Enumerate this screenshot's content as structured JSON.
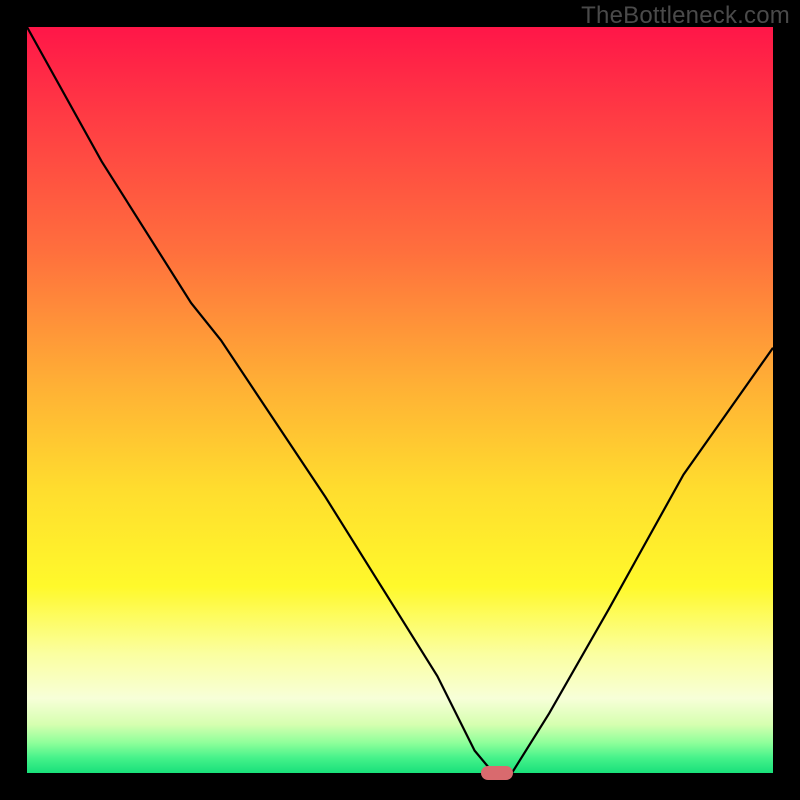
{
  "watermark": "TheBottleneck.com",
  "colors": {
    "frame": "#000000",
    "marker": "#d96a6e",
    "curve": "#000000"
  },
  "gradient_stops": [
    {
      "pct": 0,
      "color": "#ff1648"
    },
    {
      "pct": 12,
      "color": "#ff3b44"
    },
    {
      "pct": 30,
      "color": "#ff6f3d"
    },
    {
      "pct": 48,
      "color": "#ffb035"
    },
    {
      "pct": 62,
      "color": "#ffdd2e"
    },
    {
      "pct": 75,
      "color": "#fff92b"
    },
    {
      "pct": 84,
      "color": "#fbffa0"
    },
    {
      "pct": 90,
      "color": "#f7ffd8"
    },
    {
      "pct": 93.5,
      "color": "#d6ffb0"
    },
    {
      "pct": 96,
      "color": "#8dff9a"
    },
    {
      "pct": 98,
      "color": "#45f28a"
    },
    {
      "pct": 100,
      "color": "#18e07a"
    }
  ],
  "chart_data": {
    "type": "line",
    "title": "",
    "xlabel": "",
    "ylabel": "",
    "xlim": [
      0,
      100
    ],
    "ylim": [
      0,
      100
    ],
    "series": [
      {
        "name": "bottleneck-curve",
        "x": [
          0,
          10,
          22,
          26,
          40,
          55,
          60,
          62.5,
          65,
          70,
          78,
          88,
          100
        ],
        "y": [
          100,
          82,
          63,
          58,
          37,
          13,
          3,
          0,
          0,
          8,
          22,
          40,
          57
        ]
      }
    ],
    "markers": [
      {
        "name": "optimal-point",
        "x": 63,
        "y": 0
      }
    ]
  }
}
